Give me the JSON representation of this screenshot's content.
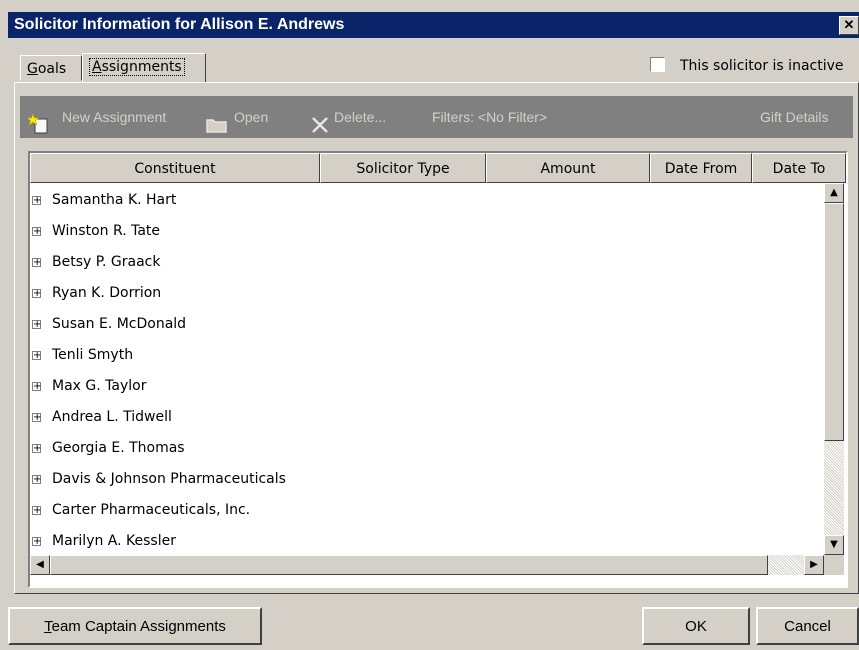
{
  "window": {
    "title": "Solicitor Information for Allison E. Andrews",
    "close_glyph": "✕"
  },
  "tabs": [
    {
      "label_first": "G",
      "label_rest": "oals"
    },
    {
      "label_first": "A",
      "label_rest": "ssignments"
    }
  ],
  "inactive_checkbox": {
    "label": "This solicitor is inactive",
    "checked": false
  },
  "toolbar": {
    "new_assignment": "New Assignment",
    "open": "Open",
    "delete": "Delete...",
    "filters": "Filters: <No Filter>",
    "gift_details": "Gift Details"
  },
  "table": {
    "columns": [
      "Constituent",
      "Solicitor Type",
      "Amount",
      "Date From",
      "Date To"
    ],
    "rows": [
      "Samantha K. Hart",
      "Winston R. Tate",
      "Betsy P. Graack",
      "Ryan K. Dorrion",
      "Susan E. McDonald",
      "Tenli Smyth",
      "Max G. Taylor",
      "Andrea L. Tidwell",
      "Georgia E. Thomas",
      "Davis & Johnson Pharmaceuticals",
      "Carter Pharmaceuticals, Inc.",
      "Marilyn A. Kessler"
    ]
  },
  "buttons": {
    "team_captain_first": "T",
    "team_captain_rest": "eam Captain Assignments",
    "ok": "OK",
    "cancel": "Cancel"
  }
}
